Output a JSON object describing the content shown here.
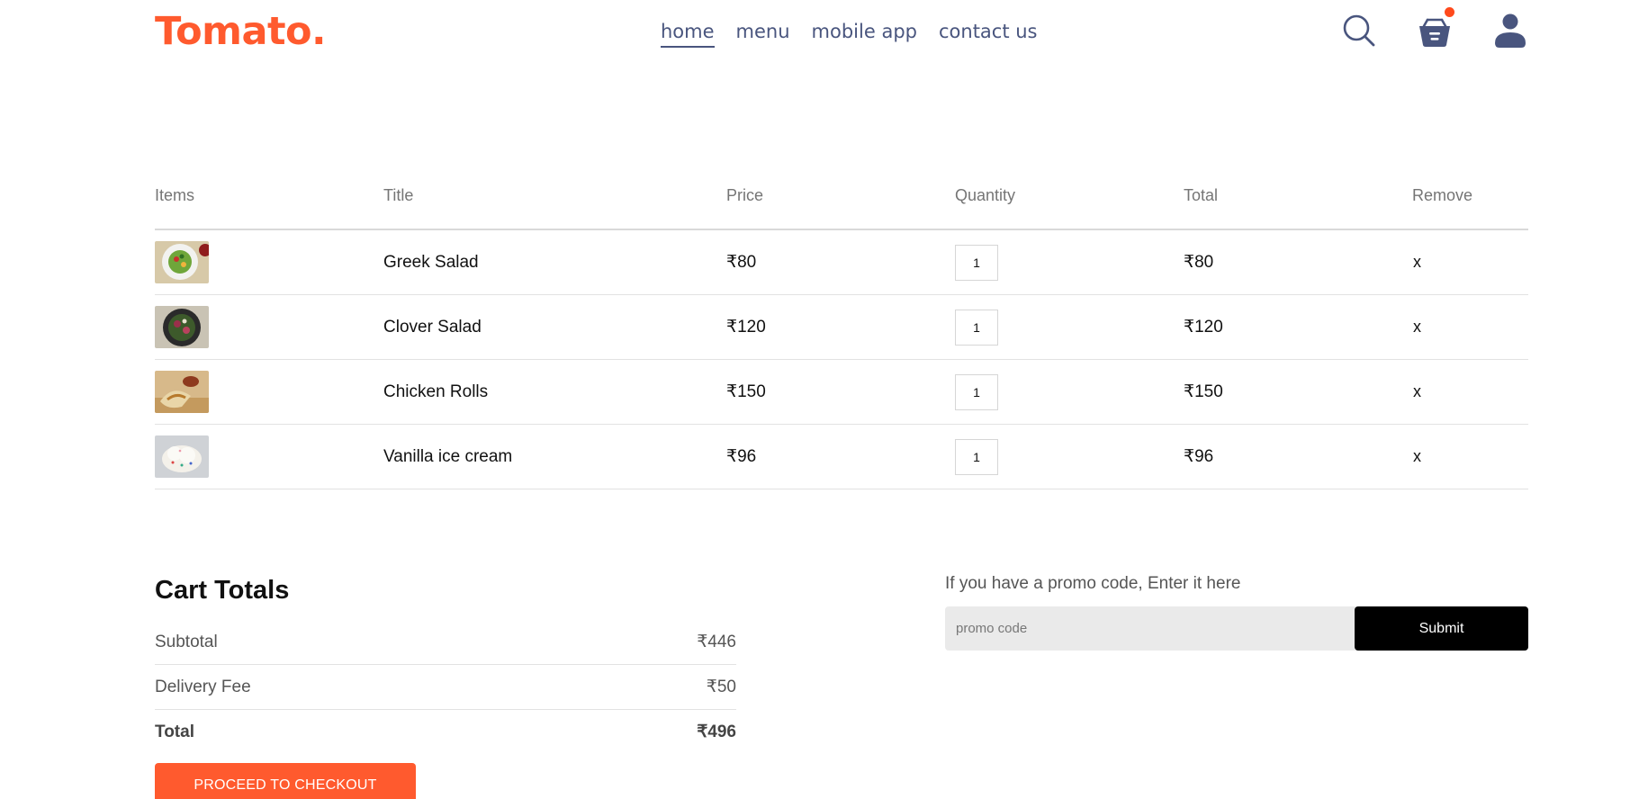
{
  "brand": {
    "logo": "Tomato."
  },
  "nav": {
    "links": [
      "home",
      "menu",
      "mobile app",
      "contact us"
    ],
    "active": "home",
    "icons": [
      "search-icon",
      "basket-icon",
      "profile-icon"
    ]
  },
  "cart": {
    "headers": [
      "Items",
      "Title",
      "Price",
      "Quantity",
      "Total",
      "Remove"
    ],
    "rows": [
      {
        "title": "Greek Salad",
        "price": "₹80",
        "quantity": "1",
        "total": "₹80",
        "remove": "x",
        "image": "greek-salad-image"
      },
      {
        "title": "Clover Salad",
        "price": "₹120",
        "quantity": "1",
        "total": "₹120",
        "remove": "x",
        "image": "clover-salad-image"
      },
      {
        "title": "Chicken Rolls",
        "price": "₹150",
        "quantity": "1",
        "total": "₹150",
        "remove": "x",
        "image": "chicken-rolls-image"
      },
      {
        "title": "Vanilla ice cream",
        "price": "₹96",
        "quantity": "1",
        "total": "₹96",
        "remove": "x",
        "image": "vanilla-ice-cream-image"
      }
    ]
  },
  "totals": {
    "title": "Cart Totals",
    "subtotal_label": "Subtotal",
    "subtotal_value": "₹446",
    "delivery_label": "Delivery Fee",
    "delivery_value": "₹50",
    "total_label": "Total",
    "total_value": "₹496",
    "checkout_label": "PROCEED TO CHECKOUT"
  },
  "promo": {
    "prompt": "If you have a promo code, Enter it here",
    "placeholder": "promo code",
    "submit_label": "Submit"
  },
  "colors": {
    "brand": "#ff5a2e",
    "nav_text": "#49557e",
    "submit_bg": "#000000"
  }
}
